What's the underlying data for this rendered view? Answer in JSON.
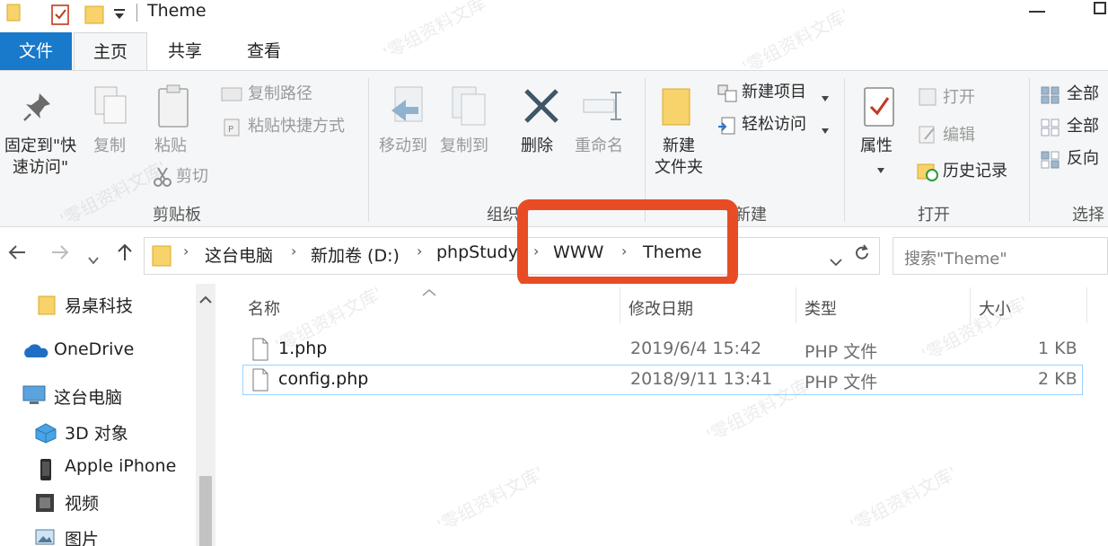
{
  "window": {
    "title": "Theme"
  },
  "tabs": {
    "file": "文件",
    "items": [
      "主页",
      "共享",
      "查看"
    ]
  },
  "ribbon": {
    "pin": "固定到\"快\n速访问\"",
    "copy": "复制",
    "paste": "粘贴",
    "copy_path": "复制路径",
    "paste_shortcut": "粘贴快捷方式",
    "cut": "剪切",
    "clipboard_group": "剪贴板",
    "move_to": "移动到",
    "copy_to": "复制到",
    "delete": "删除",
    "rename": "重命名",
    "organize_group": "组织",
    "new_folder": "新建\n文件夹",
    "new_item": "新建项目",
    "easy_access": "轻松访问",
    "new_group": "新建",
    "properties": "属性",
    "open": "打开",
    "edit": "编辑",
    "history": "历史记录",
    "open_group": "打开",
    "select_all": "全部",
    "select_none": "全部",
    "invert": "反向",
    "select_group": "选择"
  },
  "address": {
    "crumbs": [
      "这台电脑",
      "新加卷 (D:)",
      "phpStudy",
      "WWW",
      "Theme"
    ],
    "search_placeholder": "搜索\"Theme\""
  },
  "nav": {
    "items": [
      "易桌科技",
      "OneDrive",
      "这台电脑",
      "3D 对象",
      "Apple iPhone",
      "视频",
      "图片"
    ]
  },
  "files": {
    "columns": [
      "名称",
      "修改日期",
      "类型",
      "大小"
    ],
    "rows": [
      {
        "name": "1.php",
        "date": "2019/6/4 15:42",
        "type": "PHP 文件",
        "size": "1 KB"
      },
      {
        "name": "config.php",
        "date": "2018/9/11 13:41",
        "type": "PHP 文件",
        "size": "2 KB"
      }
    ]
  },
  "watermark": "'零组资料文库'",
  "colors": {
    "accent": "#1979ca",
    "highlight": "#e84c25",
    "selection": "#99d1ff"
  }
}
